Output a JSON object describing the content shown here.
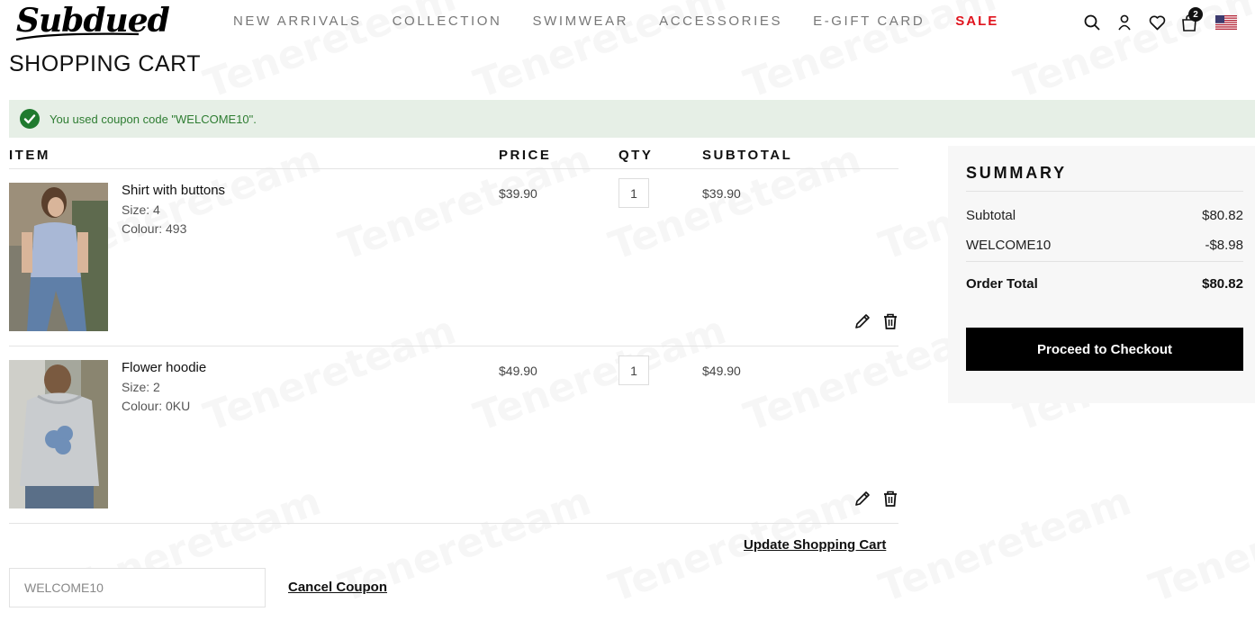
{
  "header": {
    "logo": "Subdued",
    "nav": [
      "NEW ARRIVALS",
      "COLLECTION",
      "SWIMWEAR",
      "ACCESSORIES",
      "E-GIFT CARD",
      "SALE"
    ],
    "cart_count": "2",
    "icons": [
      "search-icon",
      "account-icon",
      "wishlist-icon",
      "cart-icon",
      "us-flag-icon"
    ]
  },
  "page": {
    "title": "SHOPPING CART"
  },
  "message": {
    "text": "You used coupon code \"WELCOME10\"."
  },
  "table": {
    "headers": {
      "item": "ITEM",
      "price": "PRICE",
      "qty": "QTY",
      "subtotal": "SUBTOTAL"
    }
  },
  "items": [
    {
      "name": "Shirt with buttons",
      "size": "Size: 4",
      "colour": "Colour: 493",
      "price": "$39.90",
      "qty": "1",
      "subtotal": "$39.90"
    },
    {
      "name": "Flower hoodie",
      "size": "Size: 2",
      "colour": "Colour: 0KU",
      "price": "$49.90",
      "qty": "1",
      "subtotal": "$49.90"
    }
  ],
  "actions": {
    "update": "Update Shopping Cart",
    "coupon_value": "WELCOME10",
    "cancel_coupon": "Cancel Coupon"
  },
  "summary": {
    "title": "SUMMARY",
    "subtotal_label": "Subtotal",
    "subtotal_value": "$80.82",
    "discount_label": "WELCOME10",
    "discount_value": "-$8.98",
    "total_label": "Order Total",
    "total_value": "$80.82",
    "checkout": "Proceed to Checkout"
  },
  "watermark": "Tenereteam",
  "colors": {
    "sale": "#e0141e",
    "success_bg": "#e6efe6",
    "success_text": "#2e7d32",
    "checkout_bg": "#000000"
  }
}
